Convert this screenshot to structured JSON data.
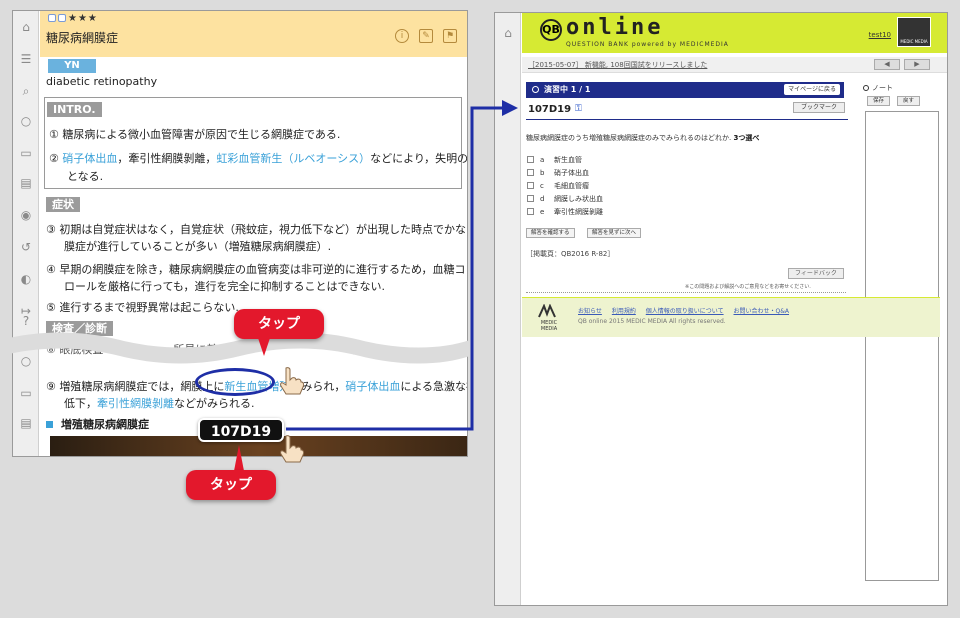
{
  "left": {
    "stars": "★★★",
    "title": "糖尿病網膜症",
    "yn": "YN",
    "english": "diabetic  retinopathy",
    "intro_label": "INTRO.",
    "intro": {
      "l1": "①  糖尿病による微小血管障害が原因で生じる網膜症である.",
      "l2a": "②  ",
      "l2b": "硝子体出血",
      "l2c": "，牽引性網膜剝離，",
      "l2d": "虹彩血管新生（ルベオーシス）",
      "l2e": "などにより，失明の原因",
      "l3": "となる."
    },
    "symptom_label": "症状",
    "symptoms": {
      "s1": "③  初期は自覚症状はなく，自覚症状（飛蚊症，視力低下など）が出現した時点でかなり網",
      "s2": "膜症が進行していることが多い（増殖糖尿病網膜症）.",
      "s3": "④  早期の網膜症を除き，糖尿病網膜症の血管病変は非可逆的に進行するため，血糖コント",
      "s4": "ロールを厳格に行っても，進行を完全に抑制することはできない.",
      "s5": "⑤  進行するまで視野異常は起こらない."
    },
    "exam_label": "検査／診断",
    "cut_line": "⑧  眼底検査",
    "cut_line_mid": "所見に基づ",
    "cut_line_end": "増殖",
    "item9": {
      "a": "⑨  増殖糖尿病網膜症では，網膜上に",
      "b": "新生血管増殖",
      "c": "がみられ，",
      "d": "硝子体出血",
      "e": "による急激な視力",
      "f": "低下，",
      "g": "牽引性網膜剝離",
      "h": "などがみられる."
    },
    "subsection": "増殖糖尿病網膜症"
  },
  "callouts": {
    "tap_top": "タップ",
    "tap_bottom": "タップ",
    "code": "107D19"
  },
  "right": {
    "logo_q": "QB",
    "logo_text": "online",
    "logo_sub": "QUESTION BANK  powered by MEDICMEDIA",
    "user": "test10",
    "brand_box": "MEDIC MEDIA",
    "news": "［2015-05-07］ 新機能, 108回国試をリリースしました",
    "nav_prev": "◀",
    "nav_next": "▶",
    "practice": "演習中 1 / 1",
    "mypage_btn": "マイページに戻る",
    "qid": "107D19",
    "bookmark_btn": "ブックマーク",
    "question_pre": "糖尿病網膜症のうち増殖糖尿病網膜症のみでみられるのはどれか.",
    "question_bold": "3つ選べ",
    "options": [
      {
        "letter": "a",
        "text": "新生血管"
      },
      {
        "letter": "b",
        "text": "硝子体出血"
      },
      {
        "letter": "c",
        "text": "毛細血管瘤"
      },
      {
        "letter": "d",
        "text": "網膜しみ状出血"
      },
      {
        "letter": "e",
        "text": "牽引性網膜剝離"
      }
    ],
    "check_btn": "解答を確認する",
    "next_btn": "解答を見ずに次へ",
    "reference": "［掲載頁：QB2016 R-82］",
    "feedback_btn": "フィードバック",
    "note_small": "※この問題および解説へのご意見などをお寄せください.",
    "side_note": "ノート",
    "save_btn": "保存",
    "back_btn": "戻す",
    "footer_links": [
      "お知らせ",
      "利用規約",
      "個人情報の取り扱いについて",
      "お問い合わせ・Q&A"
    ],
    "footer_copy": "QB online 2015 MEDIC MEDIA All rights reserved."
  },
  "colors": {
    "accent_blue": "#3aa1d8",
    "navy": "#1f2c8a",
    "lime": "#d6ea33",
    "tap_red": "#e3182c"
  }
}
